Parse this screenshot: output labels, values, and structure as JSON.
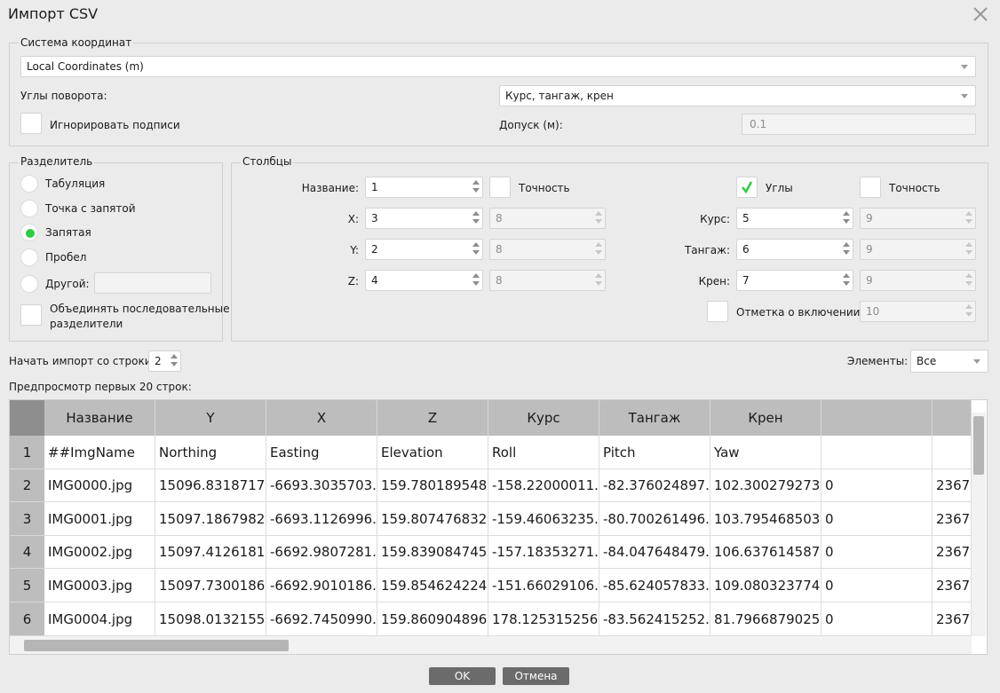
{
  "window": {
    "title": "Импорт CSV"
  },
  "coord_system": {
    "legend": "Система координат",
    "selected": "Local Coordinates (m)",
    "rotation_label": "Углы поворота:",
    "rotation_value": "Курс, тангаж, крен",
    "ignore_labels_label": "Игнорировать подписи",
    "tolerance_label": "Допуск (м):",
    "tolerance_value": "0.1"
  },
  "delimiter": {
    "legend": "Разделитель",
    "options": [
      "Табуляция",
      "Точка с запятой",
      "Запятая",
      "Пробел",
      "Другой:"
    ],
    "selected_index": 2,
    "other_value": "",
    "merge_label_line1": "Объединять последовательные",
    "merge_label_line2": "разделители"
  },
  "columns": {
    "legend": "Столбцы",
    "name_label": "Название:",
    "name_value": "1",
    "accuracy_label": "Точность",
    "x_label": "X:",
    "x_value": "3",
    "x_acc": "8",
    "y_label": "Y:",
    "y_value": "2",
    "y_acc": "8",
    "z_label": "Z:",
    "z_value": "4",
    "z_acc": "8",
    "angles_label": "Углы",
    "angles_checked": true,
    "accuracy2_label": "Точность",
    "yaw_label": "Курс:",
    "yaw_value": "5",
    "yaw_acc": "9",
    "pitch_label": "Тангаж:",
    "pitch_value": "6",
    "pitch_acc": "9",
    "roll_label": "Крен:",
    "roll_value": "7",
    "roll_acc": "9",
    "enable_mark_label": "Отметка о включении:",
    "enable_mark_value": "10"
  },
  "start_row": {
    "label": "Начать импорт со строки:",
    "value": "2"
  },
  "elements": {
    "label": "Элементы:",
    "value": "Все"
  },
  "preview": {
    "label": "Предпросмотр первых 20 строк:",
    "headers": [
      "Название",
      "Y",
      "X",
      "Z",
      "Курс",
      "Тангаж",
      "Крен",
      "",
      ""
    ],
    "rows": [
      {
        "num": "1",
        "cells": [
          "##ImgName",
          "Northing",
          "Easting",
          "Elevation",
          "Roll",
          "Pitch",
          "Yaw",
          "",
          ""
        ]
      },
      {
        "num": "2",
        "cells": [
          "IMG0000.jpg",
          "15096.8318717...",
          "-6693.3035703...",
          "159.780189548...",
          "-158.22000011...",
          "-82.376024897...",
          "102.300279273...",
          "0",
          "2367"
        ]
      },
      {
        "num": "3",
        "cells": [
          "IMG0001.jpg",
          "15097.1867982...",
          "-6693.1126996...",
          "159.807476832...",
          "-159.46063235...",
          "-80.700261496...",
          "103.795468503...",
          "0",
          "2367"
        ]
      },
      {
        "num": "4",
        "cells": [
          "IMG0002.jpg",
          "15097.4126181...",
          "-6692.9807281...",
          "159.839084745...",
          "-157.18353271...",
          "-84.047648479...",
          "106.637614587...",
          "0",
          "2367"
        ]
      },
      {
        "num": "5",
        "cells": [
          "IMG0003.jpg",
          "15097.7300186...",
          "-6692.9010186...",
          "159.854624224...",
          "-151.66029106...",
          "-85.624057833...",
          "109.080323774...",
          "0",
          "2367"
        ]
      },
      {
        "num": "6",
        "cells": [
          "IMG0004.jpg",
          "15098.0132155...",
          "-6692.7450990...",
          "159.860904896...",
          "178.125315256...",
          "-83.562415252...",
          "81.7966879025...",
          "0",
          "2367"
        ]
      }
    ]
  },
  "buttons": {
    "ok": "OK",
    "cancel": "Отмена"
  },
  "colors": {
    "radio_selected": "#2ecc40",
    "check_mark": "#2ecc40",
    "button_bg": "#6b6b6b"
  }
}
